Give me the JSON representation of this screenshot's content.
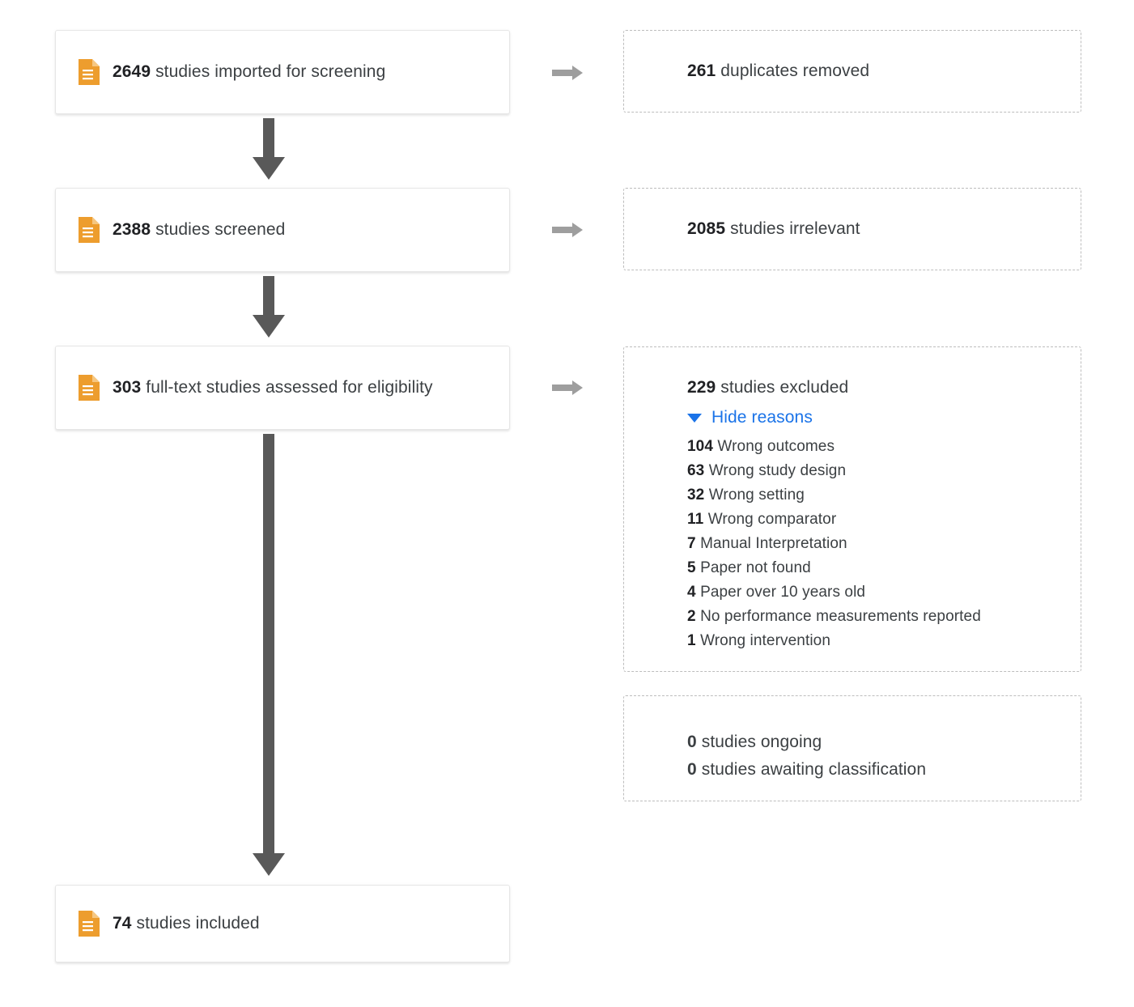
{
  "diagram": {
    "type": "prisma-flow",
    "icon_name": "document-icon",
    "accent_color": "#ed9d2e",
    "link_color": "#1a73e8",
    "arrow_color_vertical": "#595959",
    "arrow_color_horizontal": "#9e9e9e"
  },
  "flow_boxes": [
    {
      "count": "2649",
      "label": "studies imported for screening"
    },
    {
      "count": "2388",
      "label": "studies screened"
    },
    {
      "count": "303",
      "label": "full-text studies assessed for eligibility"
    },
    {
      "count": "74",
      "label": "studies included"
    }
  ],
  "side_boxes": [
    {
      "count": "261",
      "label": "duplicates removed"
    },
    {
      "count": "2085",
      "label": "studies irrelevant"
    }
  ],
  "excluded": {
    "count": "229",
    "label": "studies excluded",
    "toggle_label": "Hide reasons",
    "toggle_icon": "triangle-down-icon",
    "reasons": [
      {
        "count": "104",
        "label": "Wrong outcomes"
      },
      {
        "count": "63",
        "label": "Wrong study design"
      },
      {
        "count": "32",
        "label": "Wrong setting"
      },
      {
        "count": "11",
        "label": "Wrong comparator"
      },
      {
        "count": "7",
        "label": "Manual Interpretation"
      },
      {
        "count": "5",
        "label": "Paper not found"
      },
      {
        "count": "4",
        "label": "Paper over 10 years old"
      },
      {
        "count": "2",
        "label": "No performance measurements reported"
      },
      {
        "count": "1",
        "label": "Wrong intervention"
      }
    ]
  },
  "status": {
    "ongoing": {
      "count": "0",
      "label": "studies ongoing"
    },
    "awaiting": {
      "count": "0",
      "label": "studies awaiting classification"
    }
  }
}
